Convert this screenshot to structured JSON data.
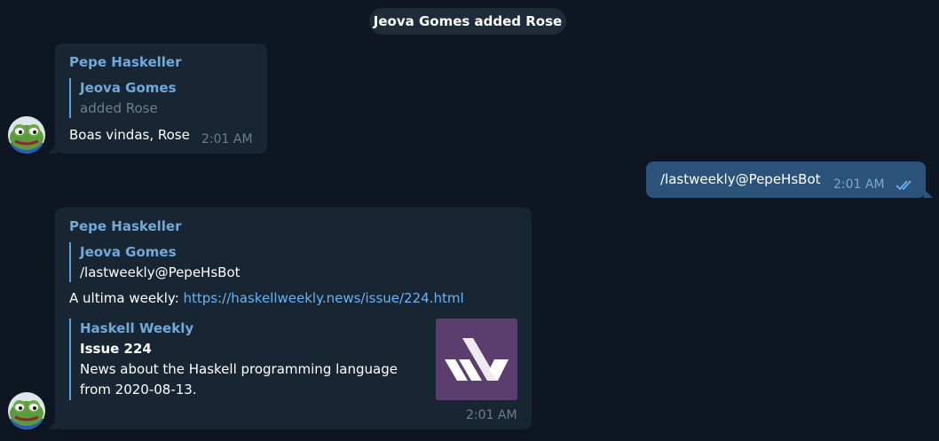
{
  "service_message": "Jeova Gomes added Rose",
  "msg1": {
    "sender": "Pepe Haskeller",
    "reply_name": "Jeova Gomes",
    "reply_text": "added Rose",
    "text": "Boas vindas, Rose",
    "time": "2:01 AM"
  },
  "msg2": {
    "text": "/lastweekly@PepeHsBot",
    "time": "2:01 AM",
    "status_icon": "double-check-icon"
  },
  "msg3": {
    "sender": "Pepe Haskeller",
    "reply_name": "Jeova Gomes",
    "reply_text": "/lastweekly@PepeHsBot",
    "text_prefix": "A ultima weekly: ",
    "link": "https://haskellweekly.news/issue/224.html",
    "preview": {
      "site": "Haskell Weekly",
      "title": "Issue 224",
      "desc_line1": "News about the Haskell programming language",
      "desc_line2": "from 2020-08-13."
    },
    "time": "2:01 AM"
  },
  "colors": {
    "background": "#0e1621",
    "bubble_in": "#182533",
    "bubble_out": "#2b5278",
    "accent": "#71a9d9",
    "link": "#6ab3f3",
    "thumb_bg": "#5c3e6e"
  }
}
